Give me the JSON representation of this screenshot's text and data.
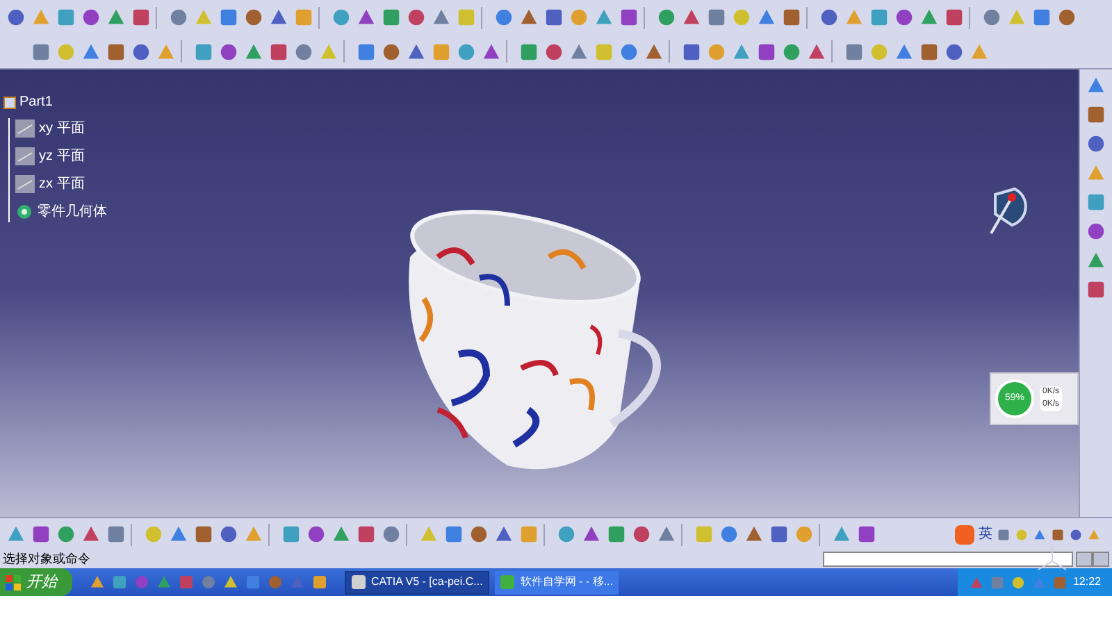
{
  "tree": {
    "root": "Part1",
    "children": [
      {
        "label": "xy 平面",
        "kind": "plane"
      },
      {
        "label": "yz 平面",
        "kind": "plane"
      },
      {
        "label": "zx 平面",
        "kind": "plane"
      },
      {
        "label": "零件几何体",
        "kind": "body"
      }
    ]
  },
  "net_monitor": {
    "percent": "59%",
    "upload": "0K/s",
    "download": "0K/s"
  },
  "ime_bar": {
    "label": "英"
  },
  "status_bar": {
    "prompt": "选择对象或命令"
  },
  "taskbar": {
    "start": "开始",
    "tasks": [
      {
        "label": "CATIA V5 - [ca-pei.C...",
        "selected": true
      },
      {
        "label": "软件自学网 - - 移...",
        "selected": false
      }
    ],
    "clock": "12:22"
  }
}
